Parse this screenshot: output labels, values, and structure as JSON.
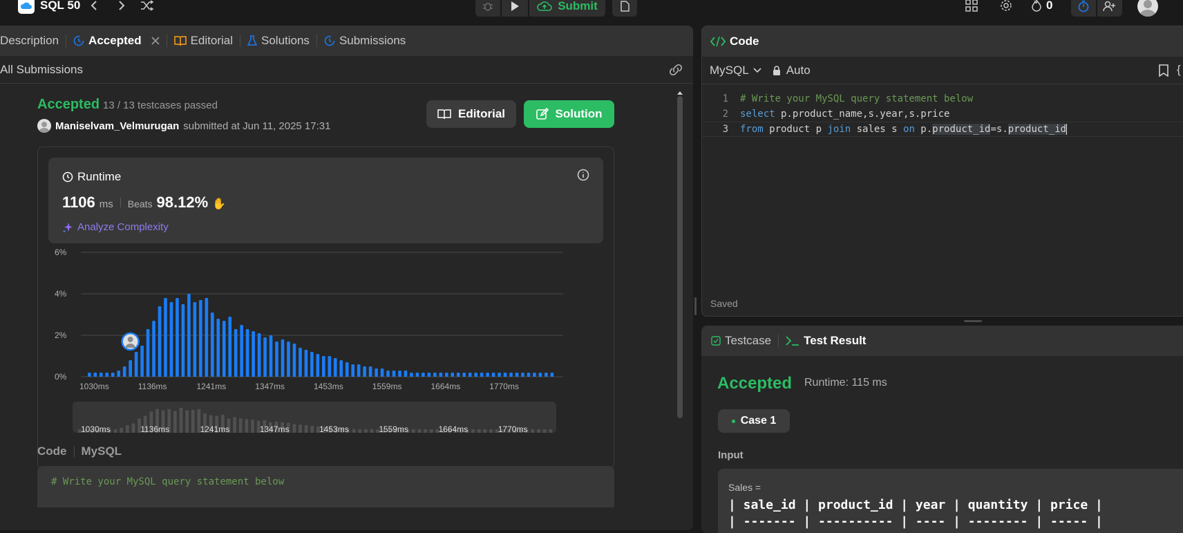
{
  "topbar": {
    "app_title": "SQL 50",
    "submit_label": "Submit",
    "streak_count": "0"
  },
  "left": {
    "tabs": {
      "description": "Description",
      "accepted": "Accepted",
      "editorial": "Editorial",
      "solutions": "Solutions",
      "submissions": "Submissions"
    },
    "all_submissions": "All Submissions",
    "status": "Accepted",
    "testcases": "13 / 13 testcases passed",
    "user": "Maniselvam_Velmurugan",
    "submitted_text": "submitted at Jun 11, 2025 17:31",
    "editorial_btn": "Editorial",
    "solution_btn": "Solution",
    "runtime": {
      "title": "Runtime",
      "value": "1106",
      "unit": "ms",
      "beats_label": "Beats",
      "beats_value": "98.12%",
      "analyze": "Analyze Complexity"
    },
    "code_label": "Code",
    "code_lang": "MySQL",
    "code_preview": "# Write your MySQL query statement below"
  },
  "chart_data": {
    "type": "bar",
    "ylabels": [
      "6%",
      "4%",
      "2%",
      "0%"
    ],
    "ylim": [
      0,
      6
    ],
    "xticks": [
      "1030ms",
      "1136ms",
      "1241ms",
      "1347ms",
      "1453ms",
      "1559ms",
      "1664ms",
      "1770ms"
    ],
    "values": [
      0.2,
      0.2,
      0.2,
      0.2,
      0.2,
      0.3,
      0.5,
      0.8,
      1.2,
      1.5,
      2.3,
      2.7,
      3.4,
      3.8,
      3.6,
      3.8,
      3.5,
      4.0,
      3.6,
      3.7,
      3.8,
      3.1,
      2.8,
      2.7,
      2.9,
      2.3,
      2.5,
      2.3,
      2.2,
      2.1,
      1.9,
      2.0,
      1.7,
      1.8,
      1.7,
      1.6,
      1.4,
      1.3,
      1.2,
      1.1,
      1.0,
      1.0,
      0.9,
      0.8,
      0.7,
      0.6,
      0.6,
      0.5,
      0.5,
      0.4,
      0.4,
      0.3,
      0.3,
      0.3,
      0.3,
      0.2,
      0.2,
      0.2,
      0.2,
      0.2,
      0.2,
      0.2,
      0.2,
      0.2,
      0.2,
      0.2,
      0.2,
      0.2,
      0.2,
      0.2,
      0.2,
      0.2,
      0.2,
      0.2,
      0.2,
      0.2,
      0.2,
      0.2,
      0.2,
      0.2
    ],
    "user_marker_value": "1106ms",
    "bar_color": "#1a7cf5"
  },
  "code_panel": {
    "title": "Code",
    "lang": "MySQL",
    "mode": "Auto",
    "lines": [
      {
        "n": "1",
        "text": "# Write your MySQL query statement below"
      },
      {
        "n": "2",
        "text": "select p.product_name,s.year,s.price"
      },
      {
        "n": "3",
        "text": "from product p join sales s on p.product_id=s.product_id"
      }
    ],
    "saved": "Saved"
  },
  "result_panel": {
    "tab_testcase": "Testcase",
    "tab_result": "Test Result",
    "status": "Accepted",
    "runtime": "Runtime: 115 ms",
    "case": "Case 1",
    "input_label": "Input",
    "table_name": "Sales =",
    "table_header": "| sale_id | product_id | year | quantity | price |",
    "table_sep": "| ------- | ---------- | ---- | -------- | ----- |"
  }
}
